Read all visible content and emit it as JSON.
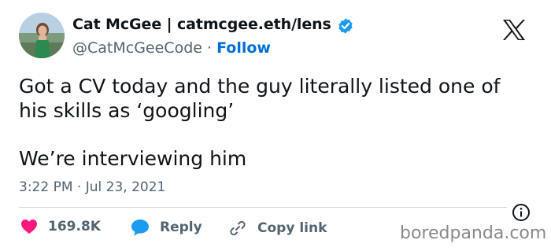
{
  "author": {
    "name": "Cat McGee | catmcgee.eth/lens",
    "handle": "@CatMcGeeCode",
    "separator": "·",
    "follow_label": "Follow"
  },
  "tweet": {
    "lines": [
      "Got a CV today and the guy literally listed one of",
      "his skills as ‘googling’",
      "We’re interviewing him"
    ],
    "timestamp": "3:22 PM · Jul 23, 2021"
  },
  "actions": {
    "like_count": "169.8K",
    "reply_label": "Reply",
    "copy_link_label": "Copy link"
  },
  "watermark": "boredpanda.com",
  "icons": [
    "avatar",
    "verified-badge-icon",
    "x-logo-icon",
    "info-icon",
    "heart-icon",
    "reply-bubble-icon",
    "link-icon"
  ],
  "colors": {
    "accent": "#006fd6",
    "verified": "#1d9bf0",
    "like": "#f91880",
    "muted_text": "#536471"
  }
}
